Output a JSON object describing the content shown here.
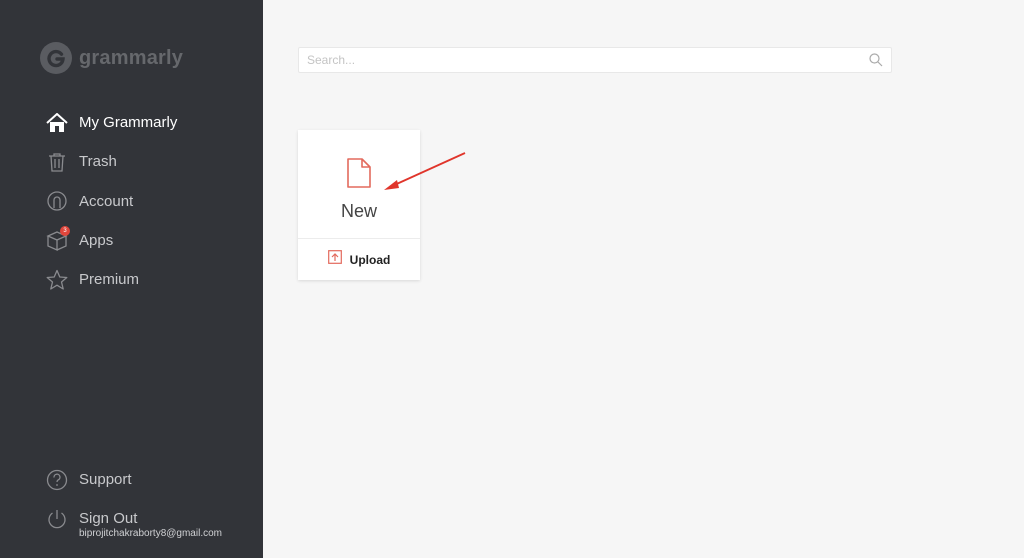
{
  "brand": {
    "name": "grammarly"
  },
  "sidebar": {
    "items": [
      {
        "label": "My Grammarly",
        "icon": "home-icon",
        "active": true
      },
      {
        "label": "Trash",
        "icon": "trash-icon"
      },
      {
        "label": "Account",
        "icon": "account-icon"
      },
      {
        "label": "Apps",
        "icon": "apps-box-icon",
        "badge": "3"
      },
      {
        "label": "Premium",
        "icon": "star-icon"
      }
    ],
    "bottom": [
      {
        "label": "Support",
        "icon": "question-icon"
      },
      {
        "label": "Sign Out",
        "icon": "power-icon"
      }
    ],
    "email": "biprojitchakraborty8@gmail.com"
  },
  "search": {
    "placeholder": "Search..."
  },
  "card": {
    "new_label": "New",
    "upload_label": "Upload"
  },
  "colors": {
    "sidebar_bg": "#323439",
    "accent": "#e36a5d",
    "annotation": "#e0352b"
  }
}
